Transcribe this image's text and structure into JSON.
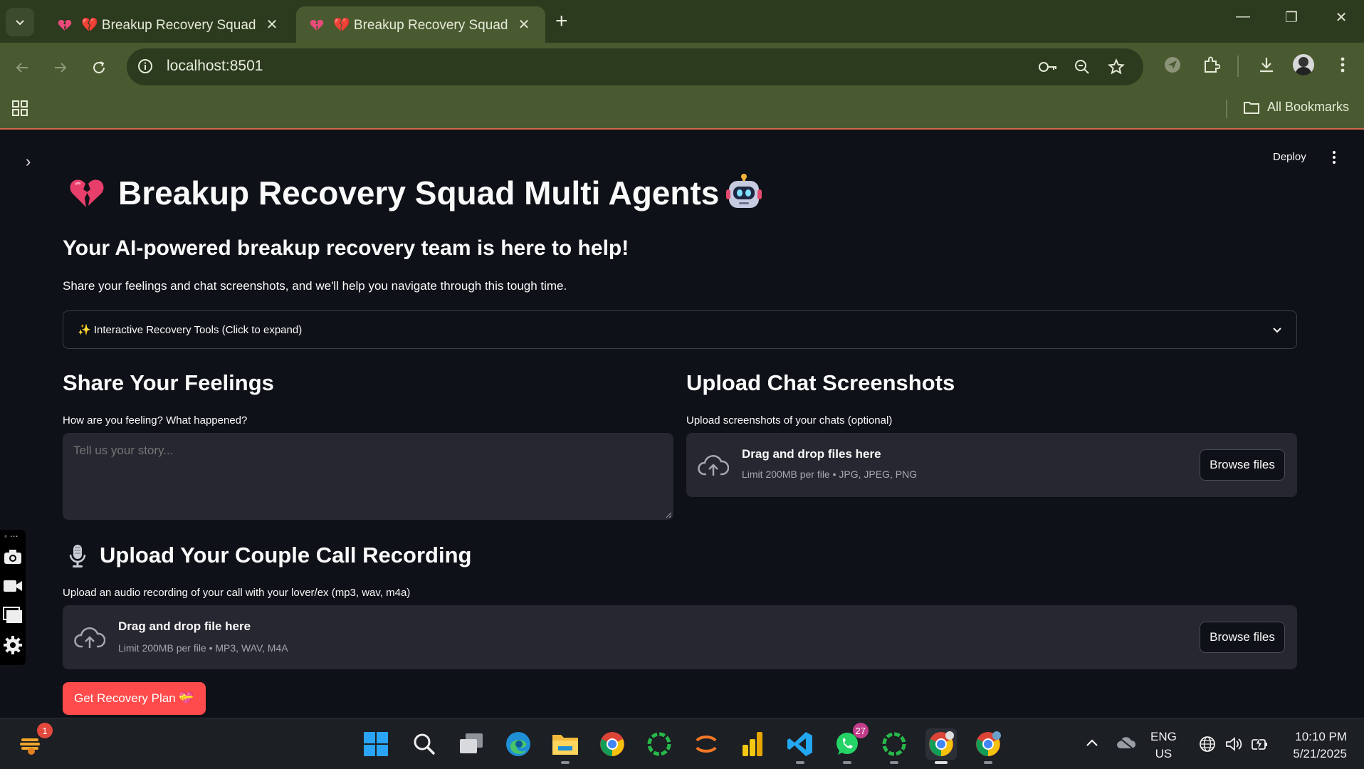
{
  "browser": {
    "tabs": [
      {
        "title": "💔 Breakup Recovery Squad",
        "active": false
      },
      {
        "title": "💔 Breakup Recovery Squad",
        "active": true
      }
    ],
    "url": "localhost:8501",
    "bookmarks_label": "All Bookmarks",
    "accent": "#4a5a30"
  },
  "app": {
    "deploy_label": "Deploy",
    "title": "Breakup Recovery Squad Multi Agents",
    "subtitle": "Your AI-powered breakup recovery team is here to help!",
    "description": "Share your feelings and chat screenshots, and we'll help you navigate through this tough time.",
    "expander_label": "✨ Interactive Recovery Tools (Click to expand)",
    "feelings": {
      "heading": "Share Your Feelings",
      "label": "How are you feeling? What happened?",
      "placeholder": "Tell us your story..."
    },
    "screenshots": {
      "heading": "Upload Chat Screenshots",
      "label": "Upload screenshots of your chats (optional)",
      "drop_title": "Drag and drop files here",
      "limit": "Limit 200MB per file • JPG, JPEG, PNG",
      "browse_label": "Browse files"
    },
    "recording": {
      "heading": "Upload Your Couple Call Recording",
      "label": "Upload an audio recording of your call with your lover/ex (mp3, wav, m4a)",
      "drop_title": "Drag and drop file here",
      "limit": "Limit 200MB per file • MP3, WAV, M4A",
      "browse_label": "Browse files"
    },
    "primary_button": "Get Recovery Plan 💝",
    "primary_color": "#ff4b4b"
  },
  "taskbar": {
    "widget_badge": "1",
    "whatsapp_badge": "27",
    "language": "ENG",
    "region": "US",
    "time": "10:10 PM",
    "date": "5/21/2025"
  }
}
